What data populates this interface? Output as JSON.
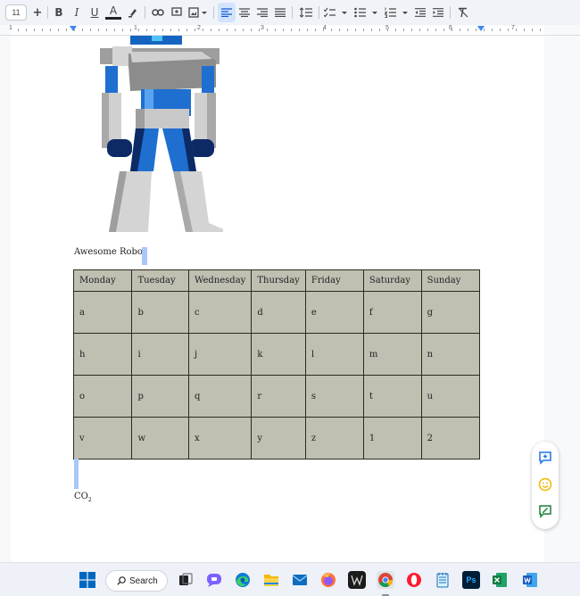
{
  "toolbar": {
    "font_size": "11",
    "increase_label": "+",
    "bold_label": "B",
    "italic_label": "I",
    "underline_label": "U",
    "text_color_label": "A",
    "accent": "#1a73e8"
  },
  "ruler": {
    "numbers": [
      "1",
      "1",
      "2",
      "3",
      "4",
      "5",
      "6",
      "7"
    ]
  },
  "document": {
    "image_caption": "Awesome Robot",
    "formula_main": "CO",
    "formula_sub": "2",
    "table": {
      "headers": [
        "Monday",
        "Tuesday",
        "Wednesday",
        "Thursday",
        "Friday",
        "Saturday",
        "Sunday"
      ],
      "rows": [
        [
          "a",
          "b",
          "c",
          "d",
          "e",
          "f",
          "g"
        ],
        [
          "h",
          "i",
          "j",
          "k",
          "l",
          "m",
          "n"
        ],
        [
          "o",
          "p",
          "q",
          "r",
          "s",
          "t",
          "u"
        ],
        [
          "v",
          "w",
          "x",
          "y",
          "z",
          "1",
          "2"
        ]
      ],
      "cell_color": "#bfc0b1"
    }
  },
  "side_actions": [
    "add-comment-icon",
    "emoji-reaction-icon",
    "suggest-edits-icon"
  ],
  "taskbar": {
    "search_label": "Search",
    "apps": [
      "windows-start-icon",
      "task-view-icon",
      "teams-chat-icon",
      "edge-icon",
      "file-explorer-icon",
      "mail-icon",
      "firefox-icon",
      "app-icon",
      "chrome-icon",
      "opera-icon",
      "notepad-icon",
      "photoshop-icon",
      "excel-icon",
      "word-icon"
    ]
  }
}
